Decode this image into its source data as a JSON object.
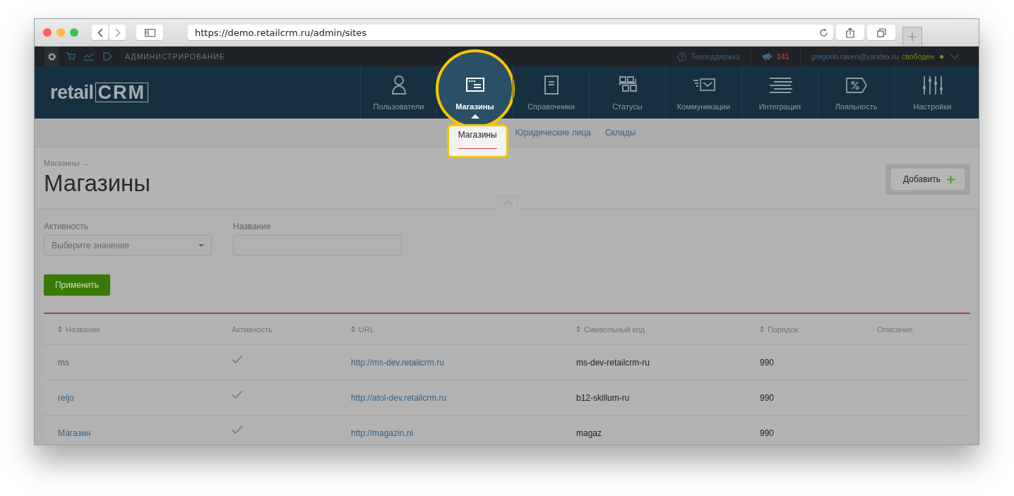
{
  "browser": {
    "url": "https://demo.retailcrm.ru/admin/sites"
  },
  "topbar": {
    "modules": [
      {
        "selected": true
      },
      {
        "selected": false
      },
      {
        "selected": false
      },
      {
        "selected": false
      }
    ],
    "section": "АДМИНИСТРИРОВАНИЕ",
    "support": "Техподдержка",
    "notifications": "141",
    "user": "gregorio.raven@yandex.ru",
    "status": "свободен"
  },
  "logo": {
    "text": "retail",
    "mark": "CRM"
  },
  "nav": [
    {
      "label": "Пользователи",
      "selected": false
    },
    {
      "label": "Магазины",
      "selected": true
    },
    {
      "label": "Справочники",
      "selected": false
    },
    {
      "label": "Статусы",
      "selected": false
    },
    {
      "label": "Коммуникации",
      "selected": false
    },
    {
      "label": "Интеграция",
      "selected": false
    },
    {
      "label": "Лояльность",
      "selected": false
    },
    {
      "label": "Настройки",
      "selected": false
    }
  ],
  "subnav": [
    {
      "label": "Магазины",
      "selected": true
    },
    {
      "label": "Юридические лица",
      "selected": false
    },
    {
      "label": "Склады",
      "selected": false
    }
  ],
  "breadcrumb": "Магазины →",
  "title": "Магазины",
  "add_button": "Добавить",
  "filters": {
    "activity": {
      "label": "Активность",
      "placeholder": "Выберите значение"
    },
    "name": {
      "label": "Название"
    },
    "apply": "Применить"
  },
  "table": {
    "columns": [
      {
        "label": "Название",
        "sortable": true
      },
      {
        "label": "Активность",
        "sortable": false
      },
      {
        "label": "URL",
        "sortable": true
      },
      {
        "label": "Символьный код",
        "sortable": true
      },
      {
        "label": "Порядок",
        "sortable": true
      },
      {
        "label": "Описание",
        "sortable": false
      }
    ],
    "rows": [
      {
        "name": "ms",
        "active": true,
        "url": "http://ms-dev.retailcrm.ru",
        "code": "ms-dev-retailcrm-ru",
        "order": "990"
      },
      {
        "name": "reijo",
        "active": true,
        "url": "http://atol-dev.retailcrm.ru",
        "code": "b12-skillum-ru",
        "order": "990"
      },
      {
        "name": "Магазин",
        "active": true,
        "url": "http://magazin.nl",
        "code": "magaz",
        "order": "990"
      }
    ]
  }
}
